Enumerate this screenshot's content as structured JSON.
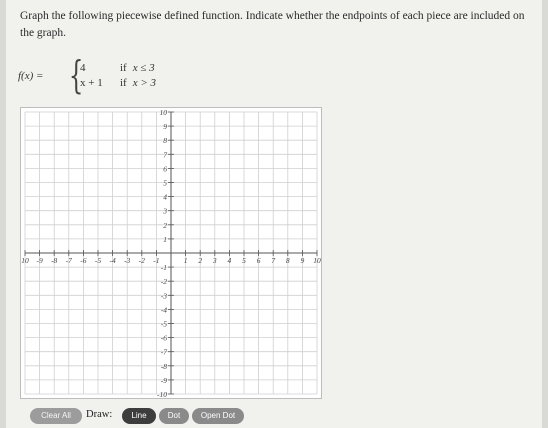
{
  "problem": {
    "instructions": "Graph the following piecewise defined function. Indicate whether the endpoints of each piece are included on the graph."
  },
  "function": {
    "lhs": "f(x) =",
    "cases": [
      {
        "expr": "4",
        "keyword": "if",
        "condition": "x ≤ 3"
      },
      {
        "expr": "x + 1",
        "keyword": "if",
        "condition": "x > 3"
      }
    ]
  },
  "graph": {
    "x_min": -10,
    "x_max": 10,
    "y_min": -10,
    "y_max": 10,
    "x_tick_labels": [
      "10",
      "-9",
      "-8",
      "-7",
      "-6",
      "-5",
      "-4",
      "-3",
      "-2",
      "-1",
      "1",
      "2",
      "3",
      "4",
      "5",
      "6",
      "7",
      "8",
      "9",
      "10"
    ],
    "y_tick_labels_pos": [
      "10",
      "9",
      "8",
      "7",
      "6",
      "5",
      "4",
      "3",
      "2",
      "1"
    ],
    "y_tick_labels_neg": [
      "-1",
      "-2",
      "-3",
      "-4",
      "-5",
      "-6",
      "-7",
      "-8",
      "-9",
      "-10"
    ],
    "grid_color": "#cfcfcf",
    "axis_color": "#555555"
  },
  "toolbar": {
    "clear_all": "Clear All",
    "draw_label": "Draw:",
    "line": "Line",
    "dot": "Dot",
    "open_dot": "Open Dot"
  }
}
